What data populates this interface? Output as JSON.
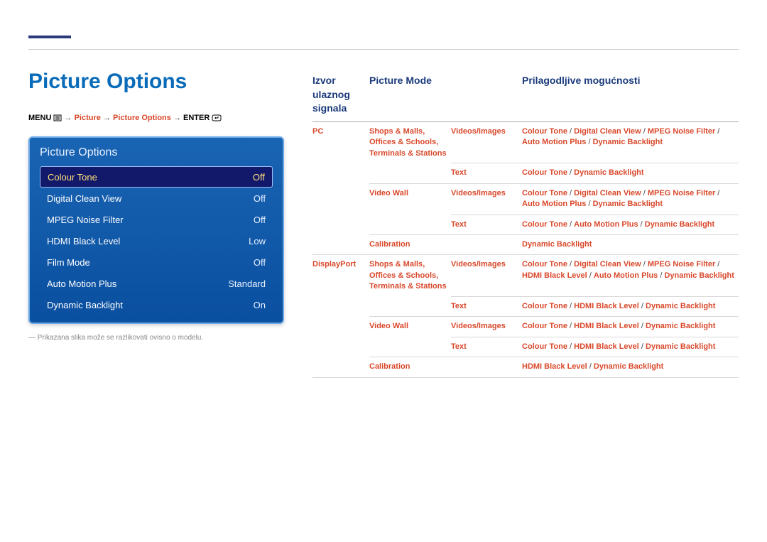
{
  "page": {
    "title": "Picture Options",
    "footnote": "Prikazana slika može se razlikovati ovisno o modelu."
  },
  "breadcrumb": {
    "menu": "MENU",
    "p1": "Picture",
    "p2": "Picture Options",
    "enter": "ENTER",
    "arrow": "→"
  },
  "osd": {
    "title": "Picture Options",
    "rows": [
      {
        "label": "Colour Tone",
        "value": "Off",
        "selected": true
      },
      {
        "label": "Digital Clean View",
        "value": "Off"
      },
      {
        "label": "MPEG Noise Filter",
        "value": "Off"
      },
      {
        "label": "HDMI Black Level",
        "value": "Low"
      },
      {
        "label": "Film Mode",
        "value": "Off"
      },
      {
        "label": "Auto Motion Plus",
        "value": "Standard"
      },
      {
        "label": "Dynamic Backlight",
        "value": "On"
      }
    ]
  },
  "table": {
    "headers": {
      "source": "Izvor ulaznog signala",
      "mode": "Picture Mode",
      "sub": "",
      "adj": "Prilagodljive mogućnosti"
    },
    "cellText": {
      "pc": "PC",
      "dp": "DisplayPort",
      "shops": "Shops & Malls",
      "offices": "Offices & Schools",
      "terminals": "Terminals & Stations",
      "videowall": "Video Wall",
      "calibration": "Calibration",
      "vidimg": "Videos/Images",
      "text": "Text",
      "ct": "Colour Tone",
      "dcv": "Digital Clean View",
      "mpeg": "MPEG Noise Filter",
      "amp": "Auto Motion Plus",
      "db": "Dynamic Backlight",
      "hbl": "HDMI Black Level",
      "comma": ",",
      "slash": " / "
    }
  }
}
